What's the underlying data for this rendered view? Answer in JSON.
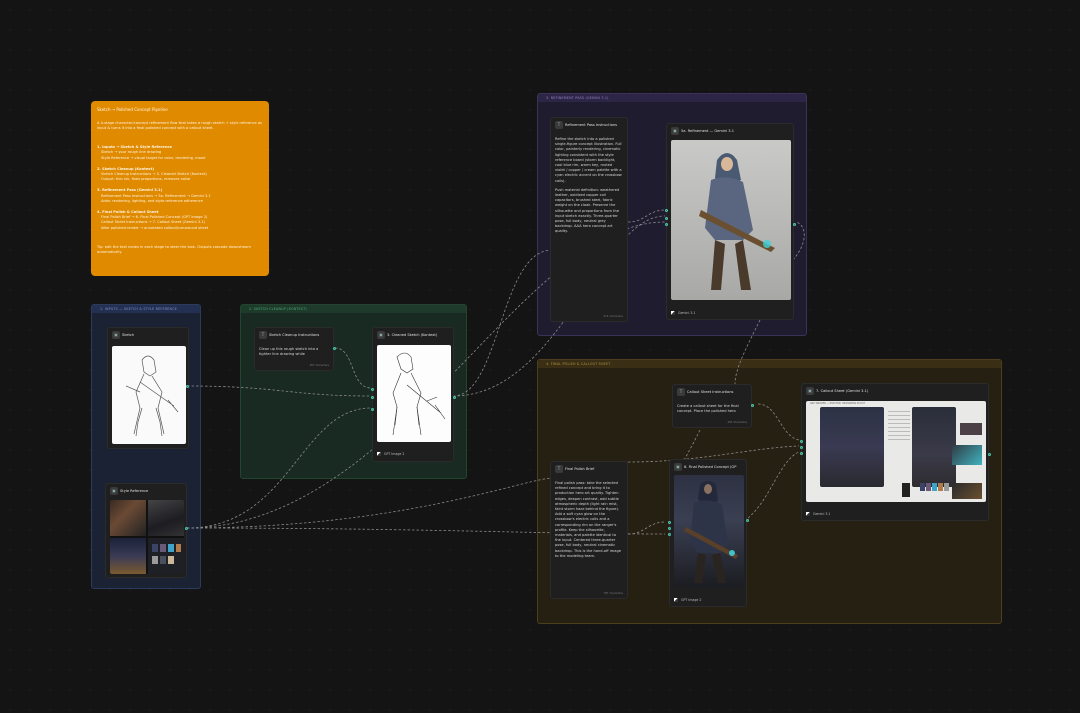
{
  "note": {
    "title": "Sketch → Polished Concept Pipeline",
    "intro": "A 4-stage character/concept refinement flow that takes a rough sketch + style reference as input & turns it into a final polished concept with a callout sheet.",
    "sections": [
      {
        "heading": "1. Inputs → Sketch & Style Reference",
        "lines": [
          "Sketch → your rough line drawing",
          "Style Reference → visual target for color, rendering, mood"
        ]
      },
      {
        "heading": "2. Sketch Cleanup (Kontext)",
        "lines": [
          "Sketch Cleanup Instructions → 3. Cleaned Sketch (Kontext)",
          "Output: thin ink, fixes proportions, removes noise"
        ]
      },
      {
        "heading": "3. Refinement Pass (Gemini 3.1)",
        "lines": [
          "Refinement Pass Instructions → 5a. Refinement → Gemini 3.1",
          "Adds: rendering, lighting, and style-reference adherence"
        ]
      },
      {
        "heading": "4. Final Polish & Callout Sheet",
        "lines": [
          "Final Polish Brief → 6. Final Polished Concept (GPT Image 2)",
          "Callout Sheet Instructions → 7. Callout Sheet (Gemini 3.1)",
          "After polished render → annotated callout/turnaround sheet"
        ]
      }
    ],
    "tip": "Tip: edit the text nodes in each stage to steer the look. Outputs cascade downstream automatically."
  },
  "groups": {
    "inputs": "1. INPUTS — SKETCH & STYLE REFERENCE",
    "cleanup": "2. SKETCH CLEANUP (KONTEXT)",
    "refinement": "3. REFINEMENT PASS (GEMINI 3.1)",
    "final": "4. FINAL POLISH & CALLOUT SHEET"
  },
  "nodes": {
    "sketch": {
      "title": "Sketch"
    },
    "style_ref": {
      "title": "Style Reference"
    },
    "cleanup_instr": {
      "title": "Sketch Cleanup Instructions",
      "body": "Clean up this rough sketch into a tighter line drawing while",
      "footer": "387 characters"
    },
    "cleaned": {
      "title": "3. Cleaned Sketch (Kontext)",
      "model": "GPT Image 2"
    },
    "refine_instr": {
      "title": "Refinement Pass Instructions",
      "body1": "Refine the sketch into a polished single-figure concept illustration. Full color, painterly rendering, cinematic lighting consistent with the style reference board (storm backlight, cool blue rim, warm key, muted violet / copper / cream palette with a cyan electric accent on the crossbow coils).",
      "body2": "Push material definition: weathered leather, oxidized copper coil capacitors, brushed steel, fabric weight on the cloak. Preserve the silhouette and proportions from the input sketch exactly. Three-quarter pose, full body, neutral grey backdrop. AAA hero concept art quality.",
      "footer": "974 characters"
    },
    "refinement": {
      "title": "5a. Refinement — Gemini 3.1",
      "model": "Gemini 3.1"
    },
    "callout_instr": {
      "title": "Callout Sheet Instructions",
      "body": "Create a callout sheet for the final concept. Place the polished hero",
      "footer": "485 characters"
    },
    "callout": {
      "title": "7. Callout Sheet (Gemini 3.1)",
      "model": "Gemini 3.1",
      "sheet_header": "ARC WEAVER — ELECTRIC CROSSBOW SCOUT"
    },
    "final_brief": {
      "title": "Final Polish Brief",
      "body": "Final polish pass: take the selected refined concept and bring it to production hero art quality. Tighten edges, deepen contrast, add subtle atmospheric depth (light rain mist, faint storm haze behind the figure). Add a soft cyan glow on the crossbow's electric coils and a corresponding rim on the ranger's profile. Keep the silhouette, materials, and palette identical to the input. Centered three-quarter pose, full body, neutral cinematic backdrop. This is the hand-off image to the modeling team.",
      "footer": "787 characters"
    },
    "final": {
      "title": "6. Final Polished Concept (GP",
      "model": "GPT Image 2"
    }
  },
  "colors": {
    "note": "#e08a00",
    "wire": "#7a7a7a",
    "port": "#4fc1b0"
  },
  "icons": [
    "text-node-icon",
    "image-node-icon",
    "model-icon"
  ]
}
